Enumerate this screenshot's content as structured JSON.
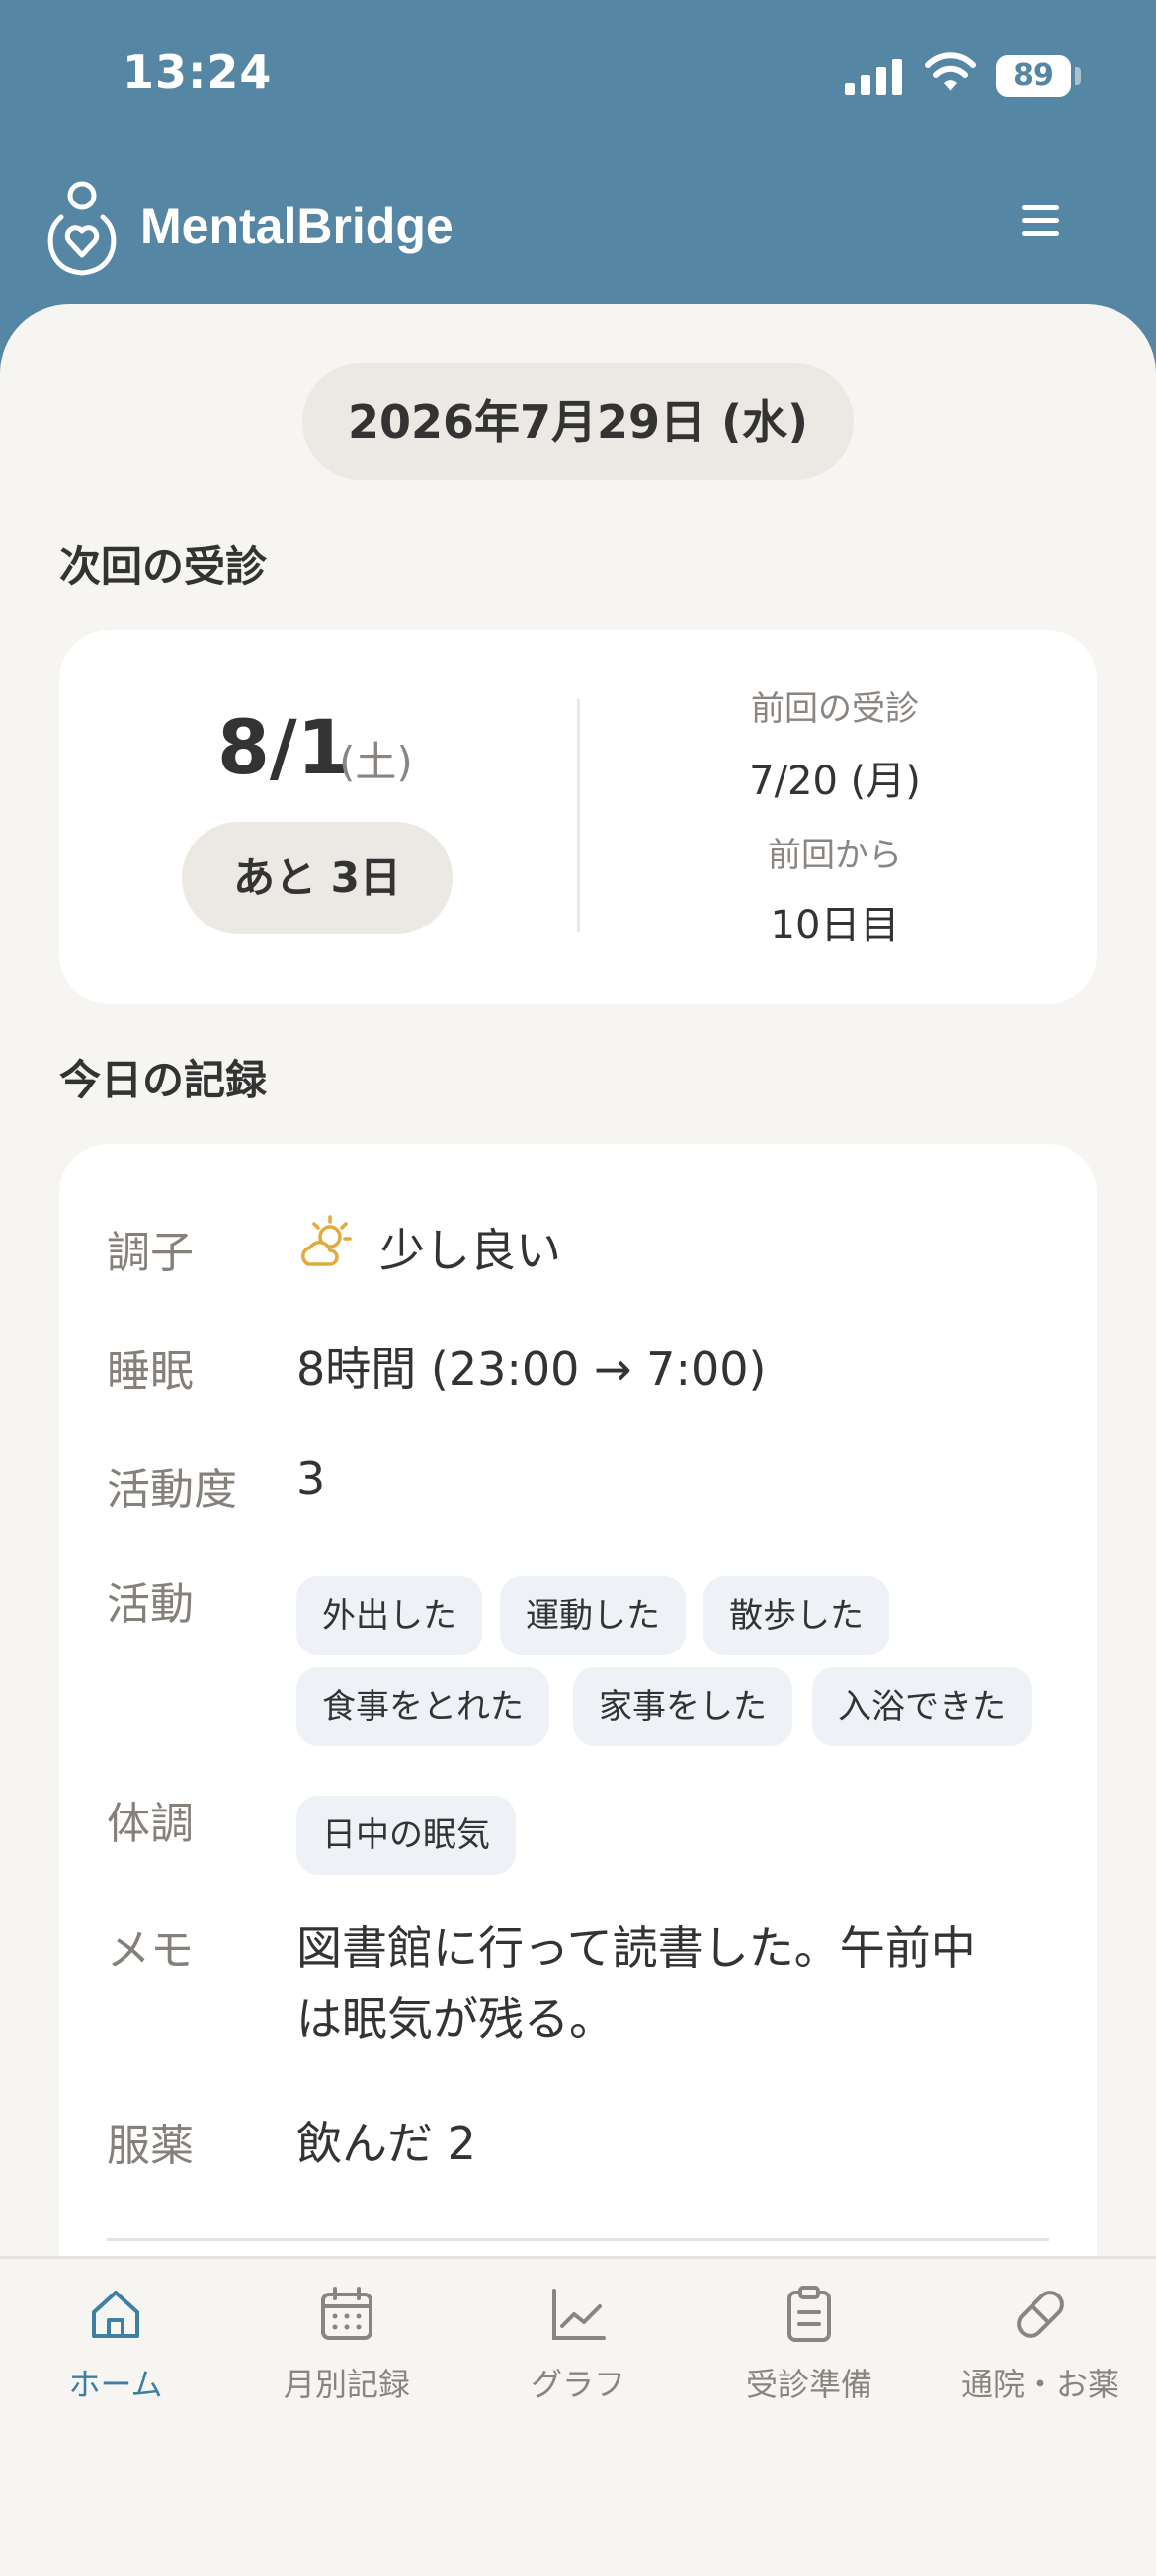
{
  "status_bar": {
    "time": "13:24",
    "battery": "89"
  },
  "header": {
    "app_title": "MentalBridge"
  },
  "current_date": "2026年7月29日 (水)",
  "next_visit": {
    "section_title": "次回の受診",
    "date": "8/1",
    "weekday": "(土)",
    "days_left": "あと 3日",
    "prev_label": "前回の受診",
    "prev_date": "7/20 (月)",
    "since_label": "前回から",
    "since_value": "10日目"
  },
  "today_record": {
    "section_title": "今日の記録",
    "condition_label": "調子",
    "condition_value": "少し良い",
    "sleep_label": "睡眠",
    "sleep_value": "8時間 (23:00 → 7:00)",
    "activity_level_label": "活動度",
    "activity_level_value": "3",
    "activities_label": "活動",
    "activities": [
      "外出した",
      "運動した",
      "散歩した",
      "食事をとれた",
      "家事をした",
      "入浴できた"
    ],
    "physical_label": "体調",
    "physical": [
      "日中の眠気"
    ],
    "memo_label": "メモ",
    "memo_line1": "図書館に行って読書した。午前中",
    "memo_line2": "は眠気が残る。",
    "medication_label": "服薬",
    "medication_value": "飲んだ 2"
  },
  "bottom_nav": [
    {
      "label": "ホーム",
      "icon": "home-icon",
      "active": true
    },
    {
      "label": "月別記録",
      "icon": "calendar-icon",
      "active": false
    },
    {
      "label": "グラフ",
      "icon": "line-chart-icon",
      "active": false
    },
    {
      "label": "受診準備",
      "icon": "clipboard-icon",
      "active": false
    },
    {
      "label": "通院・お薬",
      "icon": "pill-icon",
      "active": false
    }
  ],
  "colors": {
    "header_bg": "#5586a3",
    "sheet_bg": "#f7f5f1",
    "active_nav": "#3e7fa4",
    "condition_icon": "#e2a93b"
  }
}
